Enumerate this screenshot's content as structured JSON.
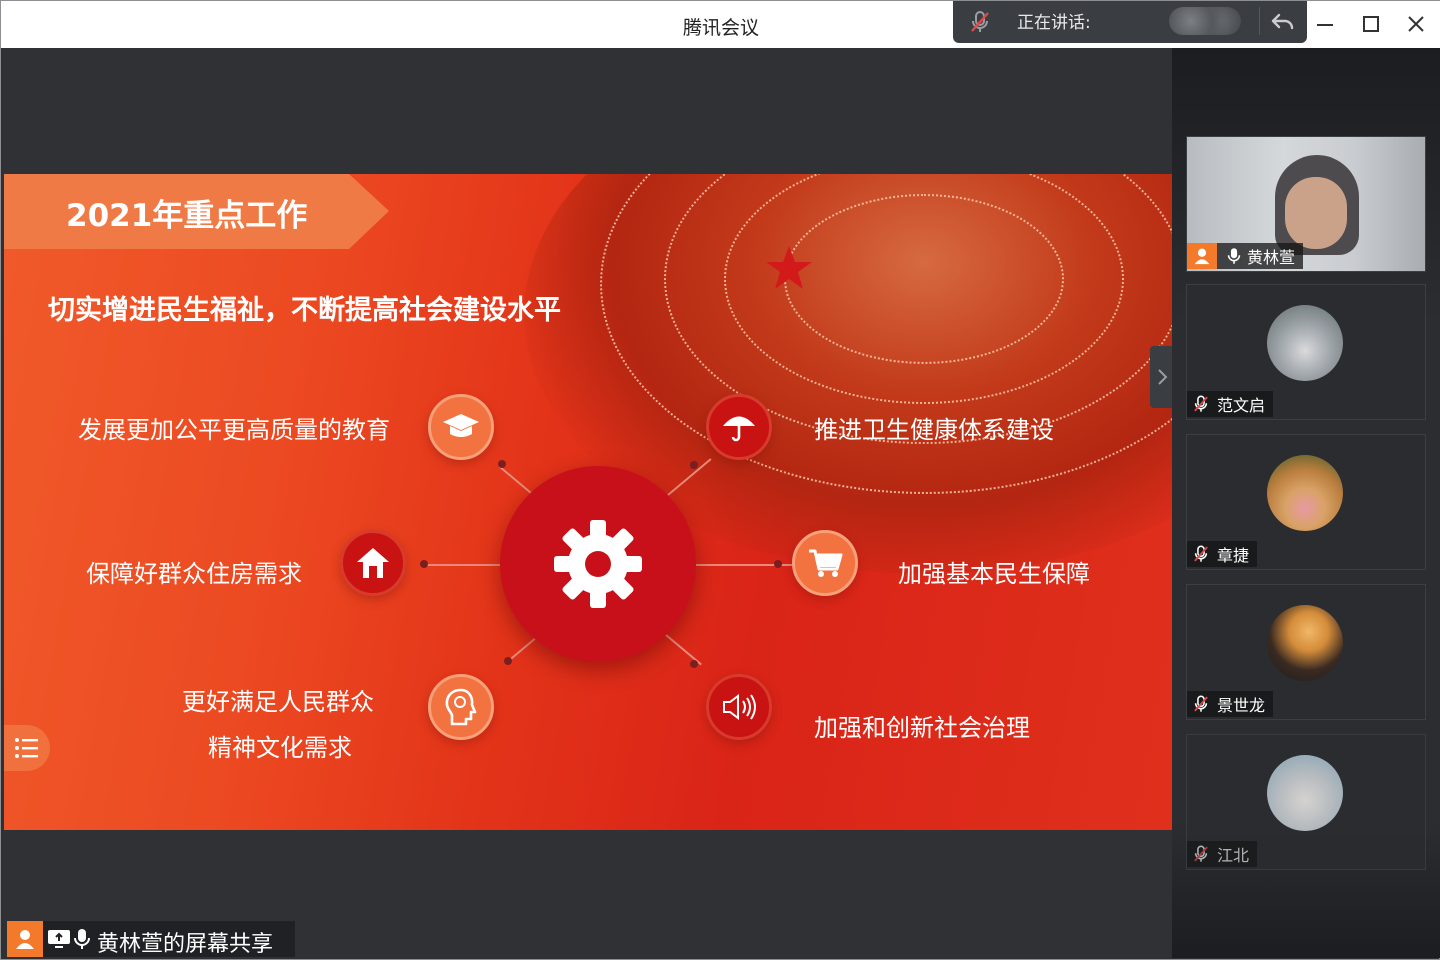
{
  "app": {
    "window_title": "腾讯会议"
  },
  "speaking_bar": {
    "label": "正在讲话:"
  },
  "slide": {
    "heading": "2021年重点工作",
    "subtitle": "切实增进民生福祉，不断提高社会建设水平",
    "items": [
      {
        "label": "发展更加公平更高质量的教育",
        "icon": "graduation-cap-icon"
      },
      {
        "label": "推进卫生健康体系建设",
        "icon": "umbrella-icon"
      },
      {
        "label": "保障好群众住房需求",
        "icon": "house-icon"
      },
      {
        "label": "加强基本民生保障",
        "icon": "cart-icon"
      },
      {
        "label_line1": "更好满足人民群众",
        "label_line2": "精神文化需求",
        "icon": "head-icon"
      },
      {
        "label": "加强和创新社会治理",
        "icon": "speaker-icon"
      }
    ],
    "hub_icon": "gear-icon"
  },
  "share_label": {
    "text": "黄林萱的屏幕共享"
  },
  "participants": [
    {
      "name": "黄林萱",
      "mic": "on",
      "video": true
    },
    {
      "name": "范文启",
      "mic": "muted"
    },
    {
      "name": "章捷",
      "mic": "muted"
    },
    {
      "name": "景世龙",
      "mic": "muted"
    },
    {
      "name": "江北",
      "mic": "muted"
    }
  ],
  "colors": {
    "accent_orange": "#f07a45",
    "slide_red": "#d92418",
    "hub_red": "#c8101a",
    "sidebar_bg": "#2b2d31"
  }
}
